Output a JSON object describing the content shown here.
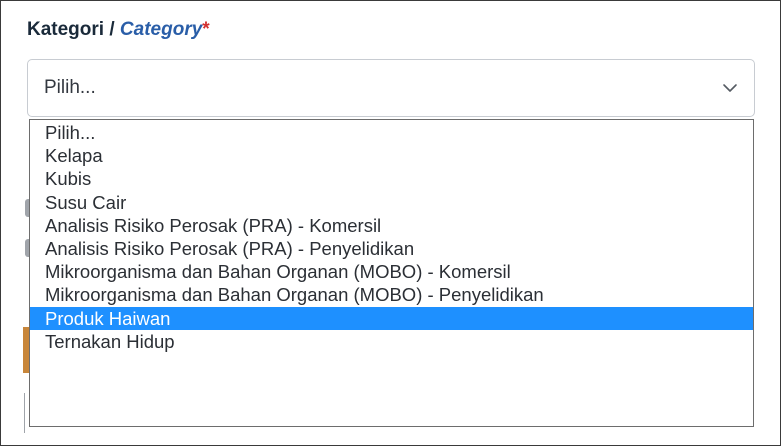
{
  "field": {
    "label_ms": "Kategori",
    "separator": " / ",
    "label_en": "Category",
    "required_mark": "*"
  },
  "select": {
    "value": "Pilih...",
    "icon": "chevron-down-icon"
  },
  "dropdown": {
    "options": [
      "Pilih...",
      "Kelapa",
      "Kubis",
      "Susu Cair",
      "Analisis Risiko Perosak (PRA) - Komersil",
      "Analisis Risiko Perosak (PRA) - Penyelidikan",
      "Mikroorganisma dan Bahan Organan (MOBO) - Komersil",
      "Mikroorganisma dan Bahan Organan (MOBO) - Penyelidikan",
      "Produk Haiwan",
      "Ternakan Hidup"
    ],
    "highlighted": "Produk Haiwan"
  },
  "colors": {
    "highlight": "#1e90ff",
    "required": "#d32f2f",
    "label_en": "#2a5ea8"
  }
}
